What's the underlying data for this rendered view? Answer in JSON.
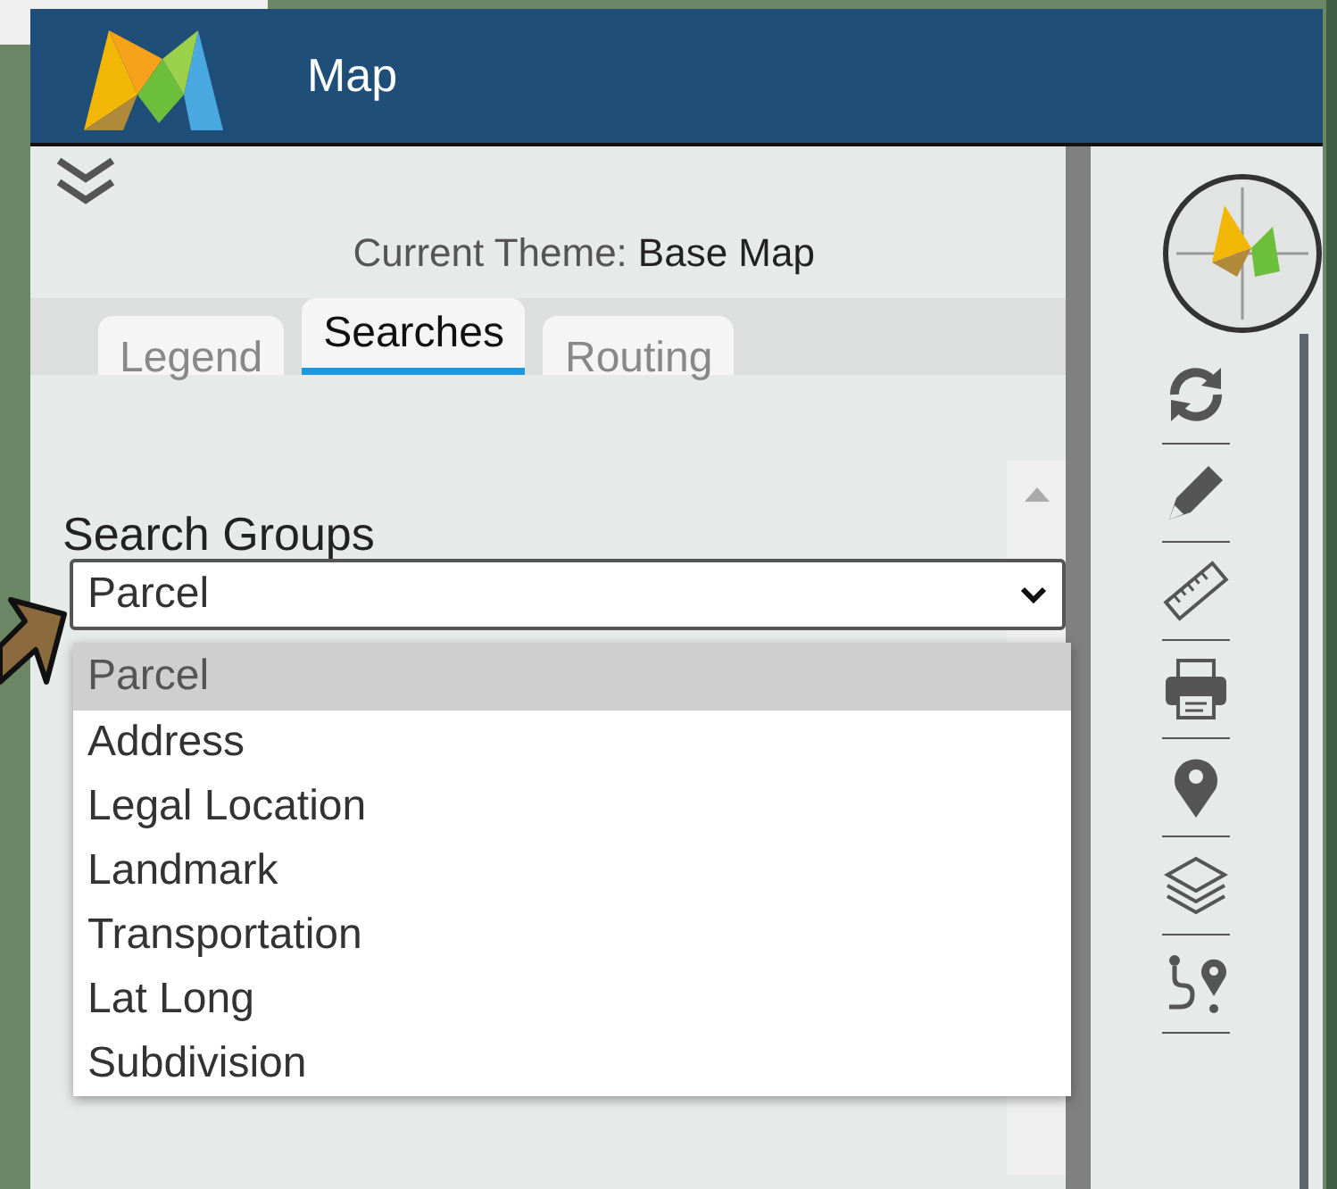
{
  "header": {
    "title": "Map"
  },
  "theme": {
    "label": "Current Theme:",
    "value": "Base Map"
  },
  "tabs": [
    {
      "label": "Legend",
      "selected": false
    },
    {
      "label": "Searches",
      "selected": true
    },
    {
      "label": "Routing",
      "selected": false
    }
  ],
  "search_groups": {
    "label": "Search Groups",
    "value": "Parcel",
    "expanded": true,
    "options": [
      {
        "label": "Parcel",
        "selected": true
      },
      {
        "label": "Address",
        "selected": false
      },
      {
        "label": "Legal Location",
        "selected": false
      },
      {
        "label": "Landmark",
        "selected": false
      },
      {
        "label": "Transportation",
        "selected": false
      },
      {
        "label": "Lat Long",
        "selected": false
      },
      {
        "label": "Subdivision",
        "selected": false
      }
    ]
  }
}
